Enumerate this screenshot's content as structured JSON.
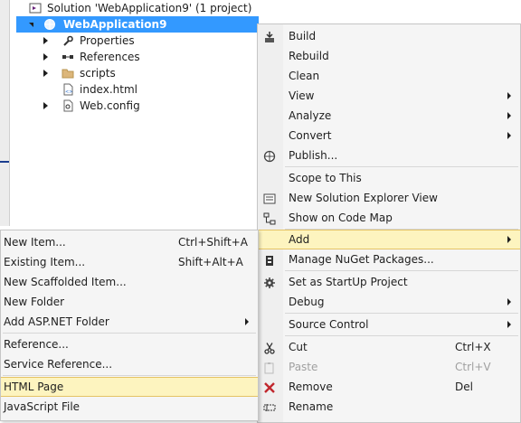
{
  "solution_explorer": {
    "solution_label": "Solution 'WebApplication9' (1 project)",
    "project_label": "WebApplication9",
    "items": [
      {
        "label": "Properties"
      },
      {
        "label": "References"
      },
      {
        "label": "scripts"
      },
      {
        "label": "index.html"
      },
      {
        "label": "Web.config"
      }
    ]
  },
  "context_menu": {
    "items": {
      "build": "Build",
      "rebuild": "Rebuild",
      "clean": "Clean",
      "view": "View",
      "analyze": "Analyze",
      "convert": "Convert",
      "publish": "Publish...",
      "scope": "Scope to This",
      "new_view": "New Solution Explorer View",
      "code_map": "Show on Code Map",
      "add": "Add",
      "nuget": "Manage NuGet Packages...",
      "startup": "Set as StartUp Project",
      "debug": "Debug",
      "source_control": "Source Control",
      "cut": "Cut",
      "cut_sc": "Ctrl+X",
      "paste": "Paste",
      "paste_sc": "Ctrl+V",
      "remove": "Remove",
      "remove_sc": "Del",
      "rename": "Rename"
    }
  },
  "add_submenu": {
    "items": {
      "new_item": "New Item...",
      "new_item_sc": "Ctrl+Shift+A",
      "existing_item": "Existing Item...",
      "existing_item_sc": "Shift+Alt+A",
      "scaffolded": "New Scaffolded Item...",
      "new_folder": "New Folder",
      "asp_folder": "Add ASP.NET Folder",
      "reference": "Reference...",
      "service_ref": "Service Reference...",
      "html_page": "HTML Page",
      "js_file": "JavaScript File"
    }
  },
  "colors": {
    "selection": "#3399ff",
    "highlight": "#fdf4bf",
    "menu_bg": "#f5f5f5"
  }
}
